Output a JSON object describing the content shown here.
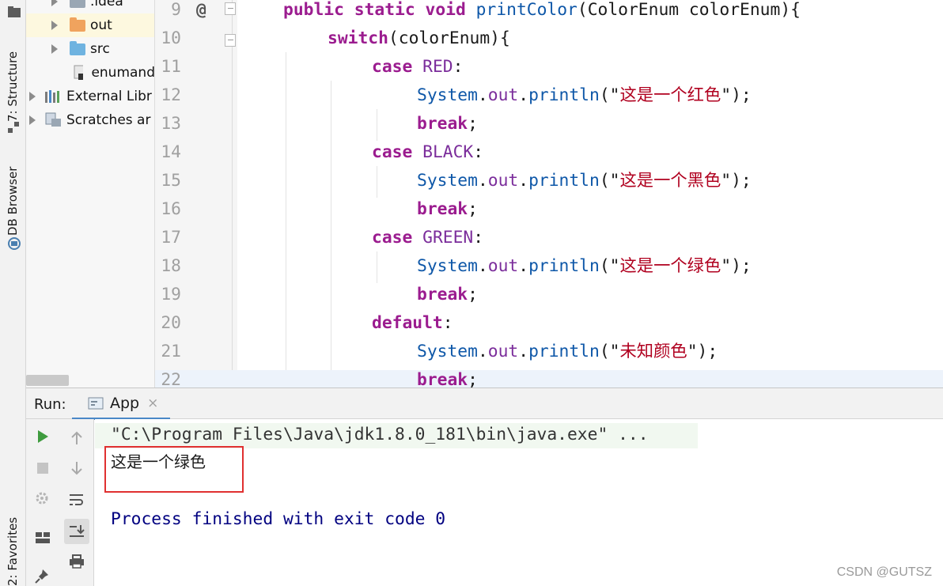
{
  "side_tabs": {
    "structure": "7: Structure",
    "db_browser": "DB Browser",
    "favorites": "2: Favorites"
  },
  "project_tree": {
    "items": [
      {
        "label": ".idea",
        "icon": "folder-icon",
        "color": "#9aa7b4"
      },
      {
        "label": "out",
        "icon": "folder-icon",
        "color": "#f0a35e"
      },
      {
        "label": "src",
        "icon": "folder-icon",
        "color": "#6fb3e0"
      },
      {
        "label": "enumand",
        "icon": "file-icon"
      },
      {
        "label": "External Libr",
        "icon": "library-icon"
      },
      {
        "label": "Scratches ar",
        "icon": "scratches-icon"
      }
    ]
  },
  "editor": {
    "gutter_marker": "@",
    "lines": [
      {
        "n": "9"
      },
      {
        "n": "10"
      },
      {
        "n": "11"
      },
      {
        "n": "12"
      },
      {
        "n": "13"
      },
      {
        "n": "14"
      },
      {
        "n": "15"
      },
      {
        "n": "16"
      },
      {
        "n": "17"
      },
      {
        "n": "18"
      },
      {
        "n": "19"
      },
      {
        "n": "20"
      },
      {
        "n": "21"
      },
      {
        "n": "22"
      }
    ],
    "tokens": {
      "public": "public",
      "static": "static",
      "void": "void",
      "method": "printColor",
      "paren_open": "(",
      "param_type": "ColorEnum",
      "param_name": " colorEnum",
      "sig_end": "){",
      "switch": "switch",
      "switch_arg": "(colorEnum){",
      "case": "case",
      "red": " RED",
      "black": " BLACK",
      "green": " GREEN",
      "colon": ":",
      "system": "System",
      "dot": ".",
      "out": "out",
      "println": "println",
      "open_str": "(\"",
      "close_str": "\");",
      "red_text": "这是一个红色",
      "black_text": "这是一个黑色",
      "green_text": "这是一个绿色",
      "unknown_text": "未知颜色",
      "break": "break",
      "semicolon": ";",
      "default": "default"
    }
  },
  "run": {
    "label": "Run:",
    "tab_label": "App",
    "close": "×",
    "command": "\"C:\\Program Files\\Java\\jdk1.8.0_181\\bin\\java.exe\" ...",
    "output": "这是一个绿色",
    "finished": "Process finished with exit code 0"
  },
  "watermark": "CSDN @GUTSZ",
  "colors": {
    "keyword": "#9b1c8f",
    "method": "#0e57a8",
    "field": "#7b2d9b",
    "console_blue": "#000080",
    "highlight_box": "#e03030"
  }
}
